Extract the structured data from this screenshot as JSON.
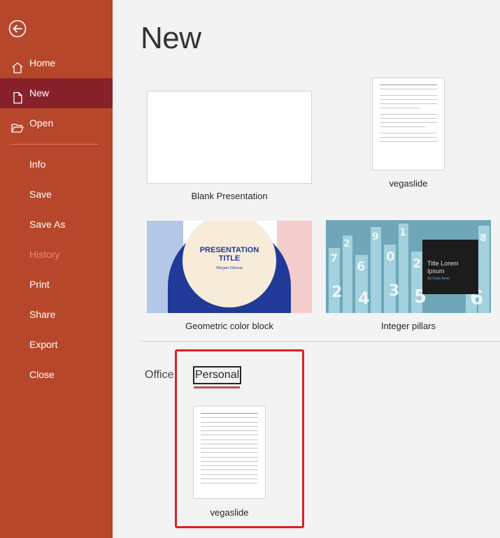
{
  "sidebar": {
    "back_icon": "back-arrow-circle-icon",
    "items": [
      {
        "label": "Home",
        "icon": "home-icon"
      },
      {
        "label": "New",
        "icon": "new-document-icon",
        "active": true
      },
      {
        "label": "Open",
        "icon": "open-folder-icon"
      },
      {
        "label": "Info"
      },
      {
        "label": "Save"
      },
      {
        "label": "Save As"
      },
      {
        "label": "History",
        "disabled": true
      },
      {
        "label": "Print"
      },
      {
        "label": "Share"
      },
      {
        "label": "Export"
      },
      {
        "label": "Close"
      }
    ]
  },
  "main": {
    "title": "New",
    "templates": [
      {
        "label": "Blank Presentation"
      },
      {
        "label": "vegaslide"
      },
      {
        "label": "Geometric color block",
        "thumb_title": "PRESENTATION TITLE",
        "thumb_subtitle": "Mirjam Nilsson"
      },
      {
        "label": "Integer pillars",
        "thumb_title": "Title Lorem Ipsum",
        "thumb_subtitle": "Sit Dolor Amet"
      }
    ],
    "tabs": {
      "office": "Office",
      "personal": "Personal"
    },
    "personal_templates": [
      {
        "label": "vegaslide"
      }
    ]
  },
  "colors": {
    "sidebar_bg": "#b7472a",
    "sidebar_active": "#87222b",
    "highlight": "#e02020",
    "tab_underline": "#c0504d"
  }
}
